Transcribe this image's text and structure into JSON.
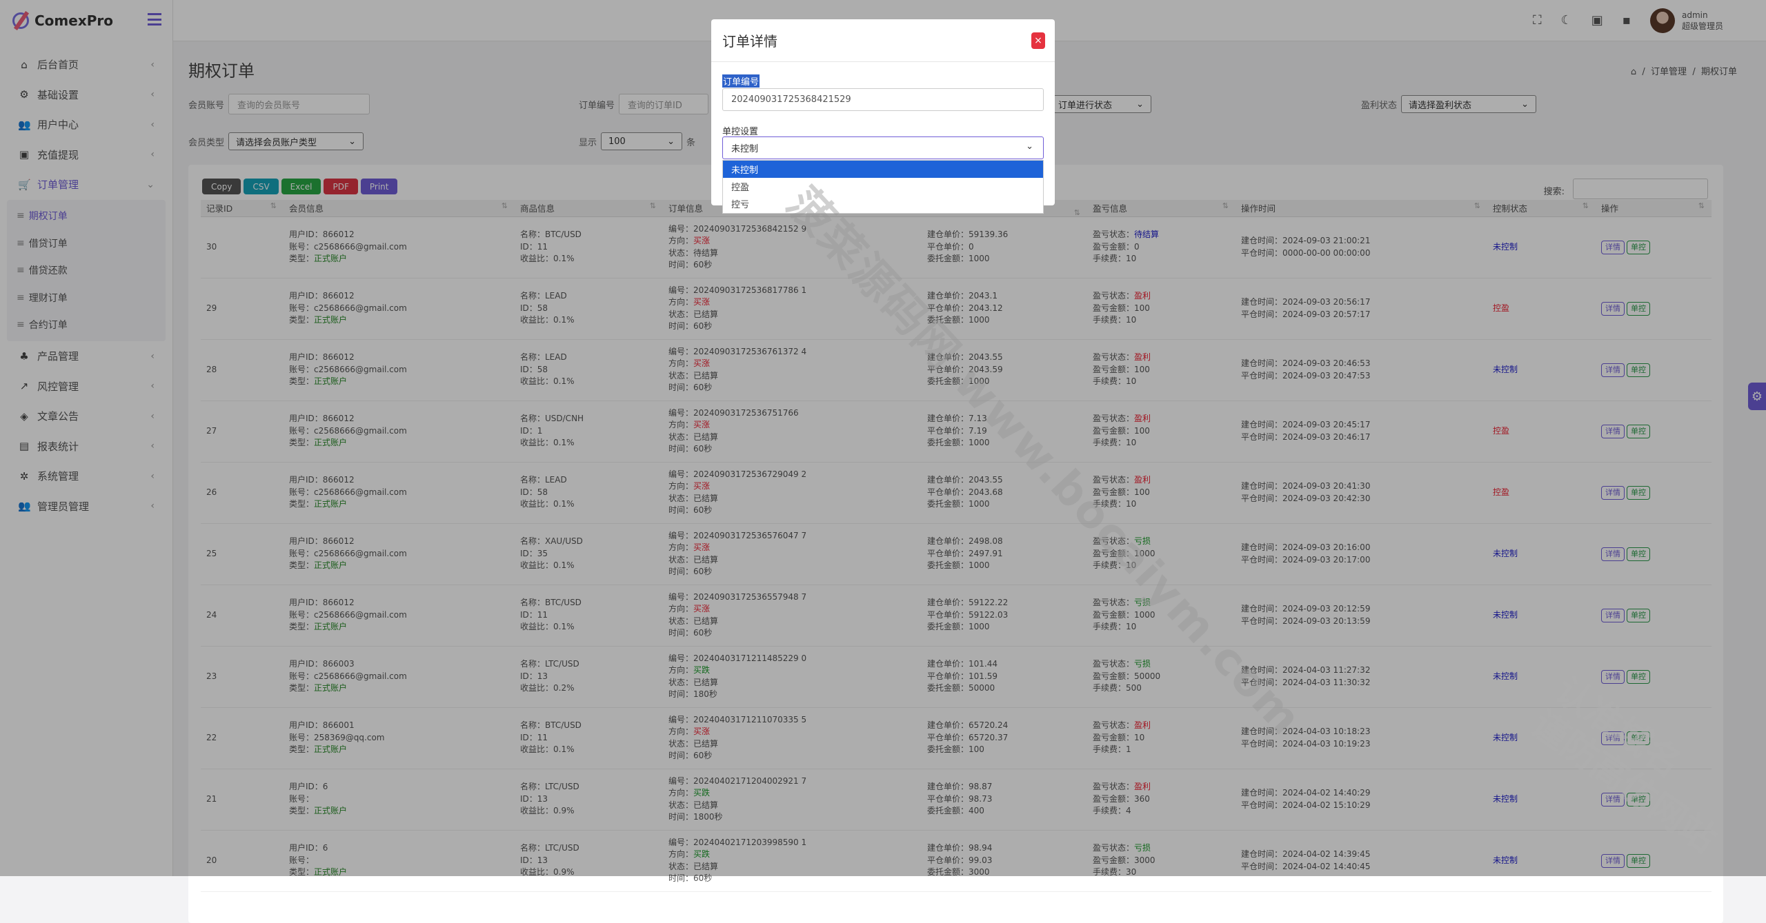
{
  "app": {
    "name": "ComexPro"
  },
  "header": {
    "admin_name": "admin",
    "admin_role": "超级管理员"
  },
  "sidebar": {
    "items": [
      {
        "label": "后台首页",
        "icon": "home-icon"
      },
      {
        "label": "基础设置",
        "icon": "cog-icon"
      },
      {
        "label": "用户中心",
        "icon": "users-icon"
      },
      {
        "label": "充值提现",
        "icon": "money-icon"
      },
      {
        "label": "订单管理",
        "icon": "cart-icon"
      },
      {
        "label": "产品管理",
        "icon": "products-icon"
      },
      {
        "label": "风控管理",
        "icon": "chart-icon"
      },
      {
        "label": "文章公告",
        "icon": "layers-icon"
      },
      {
        "label": "报表统计",
        "icon": "report-icon"
      },
      {
        "label": "系统管理",
        "icon": "gear-icon"
      },
      {
        "label": "管理员管理",
        "icon": "admin-icon"
      }
    ],
    "sub_items": [
      "期权订单",
      "借贷订单",
      "借贷还款",
      "理财订单",
      "合约订单"
    ]
  },
  "page": {
    "title": "期权订单",
    "breadcrumb": [
      "订单管理",
      "期权订单"
    ]
  },
  "filters": {
    "member_account_label": "会员账号",
    "member_account_placeholder": "查询的会员账号",
    "order_no_label": "订单编号",
    "order_no_placeholder": "查询的订单ID",
    "order_status_value": "订单进行状态",
    "profit_status_label": "盈利状态",
    "profit_status_value": "请选择盈利状态",
    "member_type_label": "会员类型",
    "member_type_value": "请选择会员账户类型",
    "show_label": "显示",
    "show_value": "100",
    "show_unit": "条"
  },
  "toolbar": {
    "buttons": [
      "Copy",
      "CSV",
      "Excel",
      "PDF",
      "Print"
    ],
    "search_label": "搜索:"
  },
  "table": {
    "columns": [
      "记录ID",
      "会员信息",
      "商品信息",
      "订单信息",
      "",
      "盈亏信息",
      "操作时间",
      "控制状态",
      "操作"
    ],
    "action_detail": "详情",
    "action_control": "单控",
    "rows": [
      {
        "id": "30",
        "uid": "用户ID：866012",
        "acct": "账号：c2568666@gmail.com",
        "type": "正式账户",
        "pname": "名称：BTC/USD",
        "pid": "ID：11",
        "rate": "收益比：0.1%",
        "ono": "编号：20240903172536842152 9",
        "dir": "买涨",
        "dircls": "red",
        "state": "状态：待结算",
        "time": "时间：60秒",
        "open": "建仓单价：59139.36",
        "close": "平仓单价：0",
        "amt": "委托金额：1000",
        "pl": "待结算",
        "plcls": "blue",
        "plamt": "盈亏金额：0",
        "fee": "手续费：10",
        "t1": "建仓时间：2024-09-03 21:00:21",
        "t2": "平仓时间：0000-00-00 00:00:00",
        "ctrl": "未控制",
        "ctrlcls": "blue"
      },
      {
        "id": "29",
        "uid": "用户ID：866012",
        "acct": "账号：c2568666@gmail.com",
        "type": "正式账户",
        "pname": "名称：LEAD",
        "pid": "ID：58",
        "rate": "收益比：0.1%",
        "ono": "编号：20240903172536817786 1",
        "dir": "买涨",
        "dircls": "red",
        "state": "状态：已结算",
        "time": "时间：60秒",
        "open": "建仓单价：2043.1",
        "close": "平仓单价：2043.12",
        "amt": "委托金额：1000",
        "pl": "盈利",
        "plcls": "red",
        "plamt": "盈亏金额：100",
        "fee": "手续费：10",
        "t1": "建仓时间：2024-09-03 20:56:17",
        "t2": "平仓时间：2024-09-03 20:57:17",
        "ctrl": "控盈",
        "ctrlcls": "red"
      },
      {
        "id": "28",
        "uid": "用户ID：866012",
        "acct": "账号：c2568666@gmail.com",
        "type": "正式账户",
        "pname": "名称：LEAD",
        "pid": "ID：58",
        "rate": "收益比：0.1%",
        "ono": "编号：20240903172536761372 4",
        "dir": "买涨",
        "dircls": "red",
        "state": "状态：已结算",
        "time": "时间：60秒",
        "open": "建仓单价：2043.55",
        "close": "平仓单价：2043.59",
        "amt": "委托金额：1000",
        "pl": "盈利",
        "plcls": "red",
        "plamt": "盈亏金额：100",
        "fee": "手续费：10",
        "t1": "建仓时间：2024-09-03 20:46:53",
        "t2": "平仓时间：2024-09-03 20:47:53",
        "ctrl": "未控制",
        "ctrlcls": "blue"
      },
      {
        "id": "27",
        "uid": "用户ID：866012",
        "acct": "账号：c2568666@gmail.com",
        "type": "正式账户",
        "pname": "名称：USD/CNH",
        "pid": "ID：1",
        "rate": "收益比：0.1%",
        "ono": "编号：20240903172536751766",
        "dir": "买涨",
        "dircls": "red",
        "state": "状态：已结算",
        "time": "时间：60秒",
        "open": "建仓单价：7.13",
        "close": "平仓单价：7.19",
        "amt": "委托金额：1000",
        "pl": "盈利",
        "plcls": "red",
        "plamt": "盈亏金额：100",
        "fee": "手续费：10",
        "t1": "建仓时间：2024-09-03 20:45:17",
        "t2": "平仓时间：2024-09-03 20:46:17",
        "ctrl": "控盈",
        "ctrlcls": "red"
      },
      {
        "id": "26",
        "uid": "用户ID：866012",
        "acct": "账号：c2568666@gmail.com",
        "type": "正式账户",
        "pname": "名称：LEAD",
        "pid": "ID：58",
        "rate": "收益比：0.1%",
        "ono": "编号：20240903172536729049 2",
        "dir": "买涨",
        "dircls": "red",
        "state": "状态：已结算",
        "time": "时间：60秒",
        "open": "建仓单价：2043.55",
        "close": "平仓单价：2043.68",
        "amt": "委托金额：1000",
        "pl": "盈利",
        "plcls": "red",
        "plamt": "盈亏金额：100",
        "fee": "手续费：10",
        "t1": "建仓时间：2024-09-03 20:41:30",
        "t2": "平仓时间：2024-09-03 20:42:30",
        "ctrl": "控盈",
        "ctrlcls": "red"
      },
      {
        "id": "25",
        "uid": "用户ID：866012",
        "acct": "账号：c2568666@gmail.com",
        "type": "正式账户",
        "pname": "名称：XAU/USD",
        "pid": "ID：35",
        "rate": "收益比：0.1%",
        "ono": "编号：20240903172536576047 7",
        "dir": "买涨",
        "dircls": "red",
        "state": "状态：已结算",
        "time": "时间：60秒",
        "open": "建仓单价：2498.08",
        "close": "平仓单价：2497.91",
        "amt": "委托金额：1000",
        "pl": "亏损",
        "plcls": "green",
        "plamt": "盈亏金额：1000",
        "fee": "手续费：10",
        "t1": "建仓时间：2024-09-03 20:16:00",
        "t2": "平仓时间：2024-09-03 20:17:00",
        "ctrl": "未控制",
        "ctrlcls": "blue"
      },
      {
        "id": "24",
        "uid": "用户ID：866012",
        "acct": "账号：c2568666@gmail.com",
        "type": "正式账户",
        "pname": "名称：BTC/USD",
        "pid": "ID：11",
        "rate": "收益比：0.1%",
        "ono": "编号：20240903172536557948 7",
        "dir": "买涨",
        "dircls": "red",
        "state": "状态：已结算",
        "time": "时间：60秒",
        "open": "建仓单价：59122.22",
        "close": "平仓单价：59122.03",
        "amt": "委托金额：1000",
        "pl": "亏损",
        "plcls": "green",
        "plamt": "盈亏金额：1000",
        "fee": "手续费：10",
        "t1": "建仓时间：2024-09-03 20:12:59",
        "t2": "平仓时间：2024-09-03 20:13:59",
        "ctrl": "未控制",
        "ctrlcls": "blue"
      },
      {
        "id": "23",
        "uid": "用户ID：866003",
        "acct": "账号：c2568666@gmail.com",
        "type": "正式账户",
        "pname": "名称：LTC/USD",
        "pid": "ID：13",
        "rate": "收益比：0.2%",
        "ono": "编号：20240403171211485229 0",
        "dir": "买跌",
        "dircls": "green",
        "state": "状态：已结算",
        "time": "时间：180秒",
        "open": "建仓单价：101.44",
        "close": "平仓单价：101.59",
        "amt": "委托金额：50000",
        "pl": "亏损",
        "plcls": "green",
        "plamt": "盈亏金额：50000",
        "fee": "手续费：500",
        "t1": "建仓时间：2024-04-03 11:27:32",
        "t2": "平仓时间：2024-04-03 11:30:32",
        "ctrl": "未控制",
        "ctrlcls": "blue"
      },
      {
        "id": "22",
        "uid": "用户ID：866001",
        "acct": "账号：258369@qq.com",
        "type": "正式账户",
        "pname": "名称：BTC/USD",
        "pid": "ID：11",
        "rate": "收益比：0.1%",
        "ono": "编号：20240403171211070335 5",
        "dir": "买涨",
        "dircls": "red",
        "state": "状态：已结算",
        "time": "时间：60秒",
        "open": "建仓单价：65720.24",
        "close": "平仓单价：65720.37",
        "amt": "委托金额：100",
        "pl": "盈利",
        "plcls": "red",
        "plamt": "盈亏金额：10",
        "fee": "手续费：1",
        "t1": "建仓时间：2024-04-03 10:18:23",
        "t2": "平仓时间：2024-04-03 10:19:23",
        "ctrl": "未控制",
        "ctrlcls": "blue"
      },
      {
        "id": "21",
        "uid": "用户ID：6",
        "acct": "账号：",
        "type": "正式账户",
        "pname": "名称：LTC/USD",
        "pid": "ID：13",
        "rate": "收益比：0.9%",
        "ono": "编号：20240402171204002921 7",
        "dir": "买跌",
        "dircls": "green",
        "state": "状态：已结算",
        "time": "时间：1800秒",
        "open": "建仓单价：98.87",
        "close": "平仓单价：98.73",
        "amt": "委托金额：400",
        "pl": "盈利",
        "plcls": "red",
        "plamt": "盈亏金额：360",
        "fee": "手续费：4",
        "t1": "建仓时间：2024-04-02 14:40:29",
        "t2": "平仓时间：2024-04-02 15:10:29",
        "ctrl": "未控制",
        "ctrlcls": "blue"
      },
      {
        "id": "20",
        "uid": "用户ID：6",
        "acct": "账号：",
        "type": "正式账户",
        "pname": "名称：LTC/USD",
        "pid": "ID：13",
        "rate": "收益比：0.9%",
        "ono": "编号：20240402171203998590 1",
        "dir": "买跌",
        "dircls": "green",
        "state": "状态：已结算",
        "time": "时间：60秒",
        "open": "建仓单价：98.94",
        "close": "平仓单价：99.03",
        "amt": "委托金额：3000",
        "pl": "亏损",
        "plcls": "green",
        "plamt": "盈亏金额：3000",
        "fee": "手续费：30",
        "t1": "建仓时间：2024-04-02 14:39:45",
        "t2": "平仓时间：2024-04-02 14:40:45",
        "ctrl": "未控制",
        "ctrlcls": "blue"
      }
    ]
  },
  "row_labels": {
    "type_prefix": "类型：",
    "dir_prefix": "方向：",
    "pl_prefix": "盈亏状态："
  },
  "modal": {
    "title": "订单详情",
    "close": "×",
    "order_no_label": "订单编号",
    "order_no_value": "202409031725368421529",
    "control_label": "单控设置",
    "control_value": "未控制",
    "options": [
      "未控制",
      "控盈",
      "控亏"
    ]
  },
  "watermark": {
    "main": "菠菜源码网 www.bocaiym.com",
    "corner_1": "认准域名",
    "corner_2": "谨防高仿网站"
  }
}
